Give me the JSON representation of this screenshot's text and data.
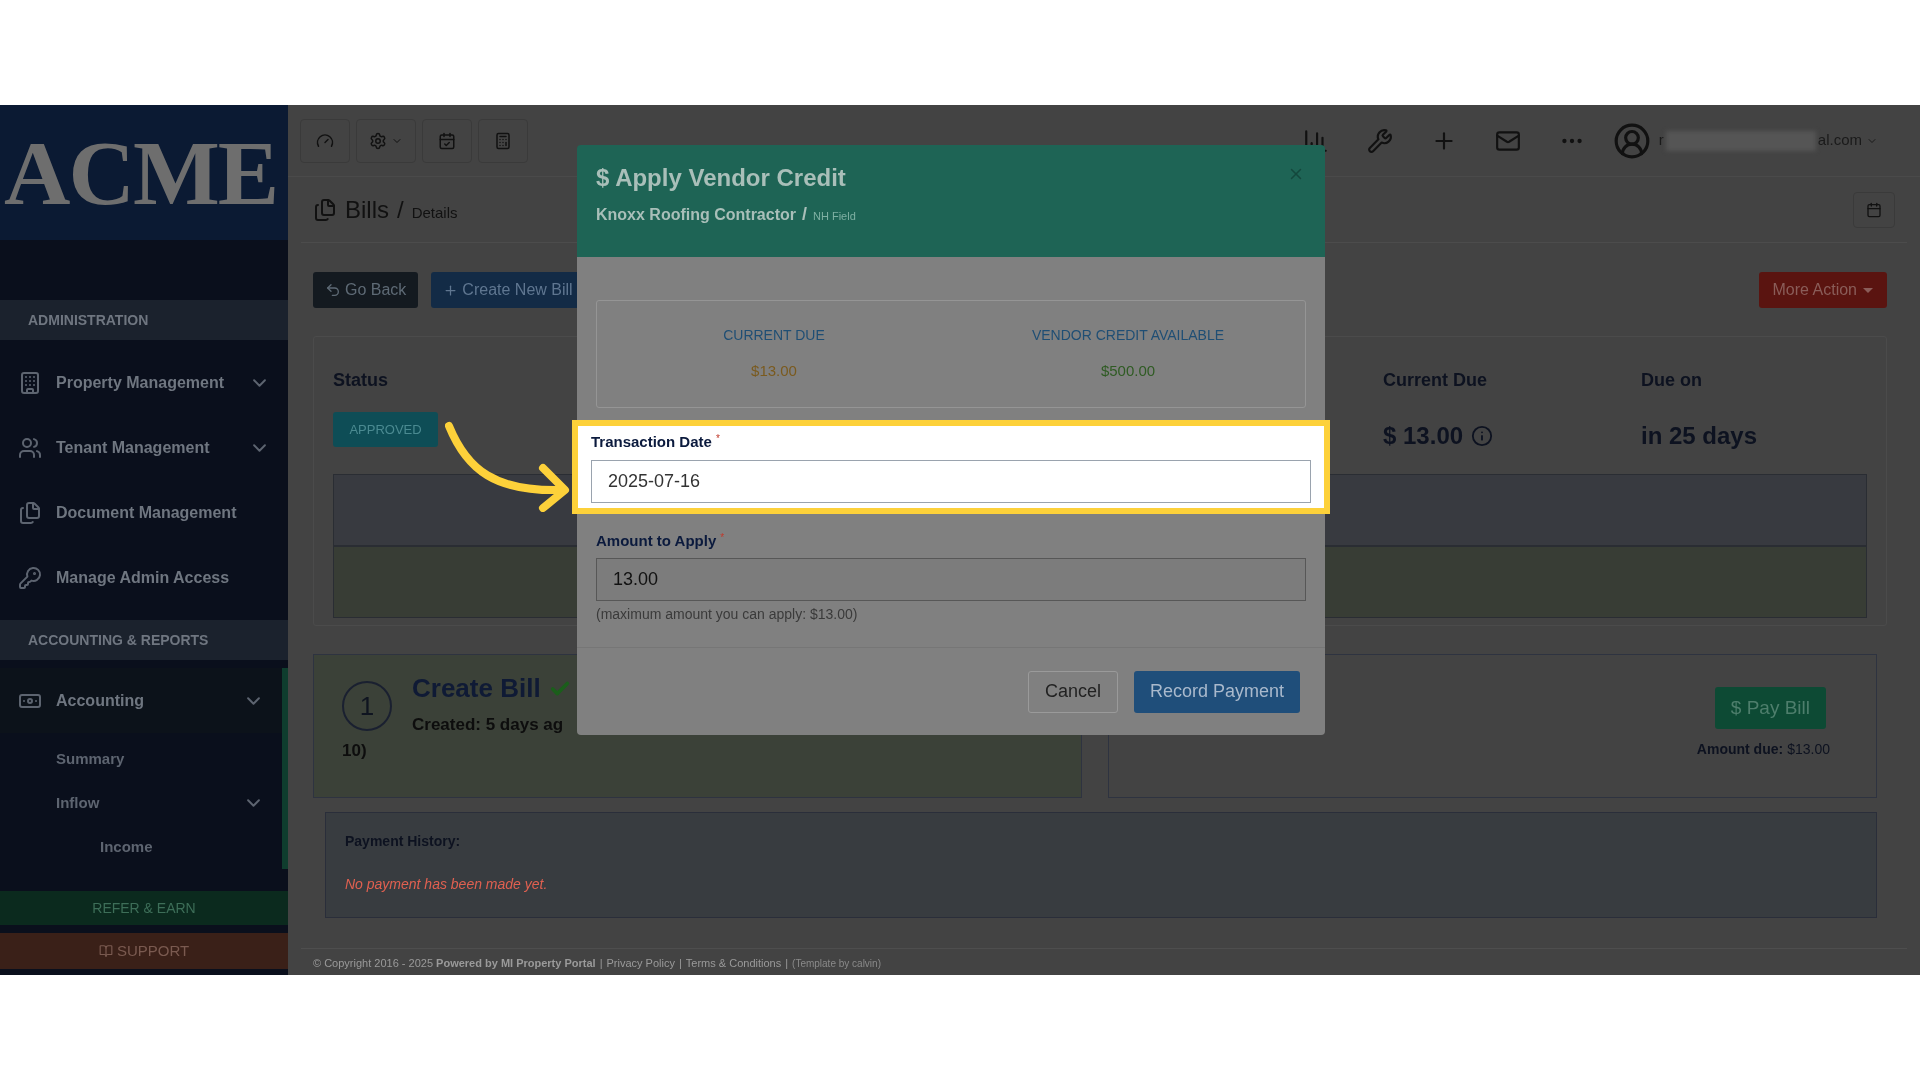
{
  "sidebar": {
    "logo": "ACME",
    "sections": [
      {
        "title": "ADMINISTRATION",
        "items": [
          {
            "label": "Property Management",
            "caret": true,
            "selected": false
          },
          {
            "label": "Tenant Management",
            "caret": true,
            "selected": false
          },
          {
            "label": "Document Management",
            "caret": false,
            "selected": false
          },
          {
            "label": "Manage Admin Access",
            "caret": false,
            "selected": false
          }
        ]
      },
      {
        "title": "ACCOUNTING & REPORTS",
        "items": [
          {
            "label": "Accounting",
            "caret": true,
            "selected": true,
            "children": [
              {
                "label": "Summary",
                "caret": false
              },
              {
                "label": "Inflow",
                "caret": true,
                "children": [
                  {
                    "label": "Income",
                    "caret": false
                  }
                ]
              }
            ]
          }
        ]
      }
    ],
    "refer": "REFER & EARN",
    "support": "SUPPORT"
  },
  "topbar": {
    "user_start": "r",
    "user_end": "al.com"
  },
  "breadcrumb": {
    "title": "Bills",
    "separator": "/",
    "current": "Details"
  },
  "actions": {
    "back": "Go Back",
    "create": "Create New Bill",
    "more": "More Action"
  },
  "summary": {
    "status_label": "Status",
    "status": "APPROVED",
    "current_due_label": "Current Due",
    "current_due": "$ 13.00",
    "due_on_label": "Due on",
    "due_on": "in 25 days"
  },
  "steps": {
    "step1_number": "1",
    "step1_title": "Create Bill",
    "step1_text": "Created: 5 days ag",
    "step1_extra": "10)",
    "pay_button": "$ Pay Bill",
    "amount_due_label": "Amount due:",
    "amount_due": "$13.00"
  },
  "payment_history": {
    "title": "Payment History:",
    "empty": "No payment has been made yet."
  },
  "footer_separator": "|",
  "footer": [
    "© Copyright 2016 - 2025 **Powered by MI Property Portal**",
    "Privacy Policy",
    "Terms & Conditions",
    "(Template by calvin)"
  ],
  "modal": {
    "title": "$ Apply Vendor Credit",
    "vendor": "Knoxx Roofing Contractor",
    "separator": "/",
    "property": "NH Field",
    "stats": [
      {
        "label": "CURRENT DUE",
        "value": "$13.00",
        "color": "#7a5a1e"
      },
      {
        "label": "VENDOR CREDIT AVAILABLE",
        "value": "$500.00",
        "color": "#2f5b23"
      }
    ],
    "fields": [
      {
        "label": "Transaction Date",
        "required_mark": "*",
        "value": "2025-07-16",
        "highlighted": true
      },
      {
        "label": "Amount to Apply",
        "required_mark": "*",
        "value": "13.00",
        "hint": "(maximum amount you can apply: $13.00)",
        "highlighted": false
      }
    ],
    "buttons": [
      {
        "label": "Cancel",
        "kind": "secondary"
      },
      {
        "label": "Record Payment",
        "kind": "primary"
      }
    ]
  }
}
